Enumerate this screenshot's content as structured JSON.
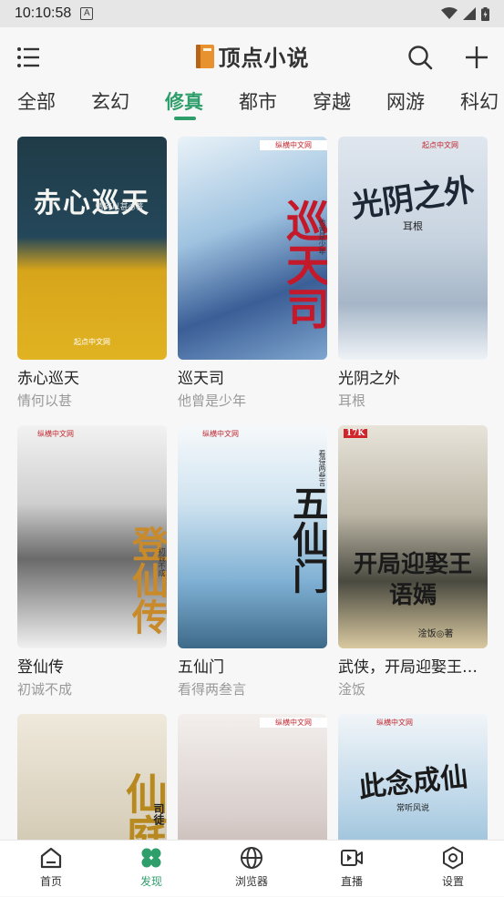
{
  "status_bar": {
    "time": "10:10:58",
    "notification_icon": "A"
  },
  "header": {
    "title": "顶点小说",
    "menu_icon": "menu-icon",
    "book_icon": "book-icon",
    "search_icon": "search-icon",
    "add_icon": "plus-icon"
  },
  "tabs": [
    {
      "label": "全部",
      "active": false
    },
    {
      "label": "玄幻",
      "active": false
    },
    {
      "label": "修真",
      "active": true
    },
    {
      "label": "都市",
      "active": false
    },
    {
      "label": "穿越",
      "active": false
    },
    {
      "label": "网游",
      "active": false
    },
    {
      "label": "科幻",
      "active": false
    }
  ],
  "books": [
    {
      "title": "赤心巡天",
      "author": "情何以甚",
      "cover_text": "赤心巡天",
      "cover_sub": "情何以甚◎著",
      "cover_publisher": "起点中文网"
    },
    {
      "title": "巡天司",
      "author": "他曾是少年",
      "cover_text": "巡天司",
      "cover_sub": "他曾是少年",
      "cover_publisher": "纵横中文网"
    },
    {
      "title": "光阴之外",
      "author": "耳根",
      "cover_text": "光阴之外",
      "cover_sub": "耳根",
      "cover_publisher": "起点中文网"
    },
    {
      "title": "登仙传",
      "author": "初诚不成",
      "cover_text": "登仙传",
      "cover_sub": "初诚不成",
      "cover_publisher": "纵横中文网"
    },
    {
      "title": "五仙门",
      "author": "看得两叁言",
      "cover_text": "五仙门",
      "cover_sub": "看得两叁言",
      "cover_publisher": "纵横中文网"
    },
    {
      "title": "武侠，开局迎娶王语嫣",
      "author": "淦饭",
      "cover_text": "开局迎娶王语嫣",
      "cover_sub": "淦饭◎著",
      "cover_publisher": "17K"
    },
    {
      "title": "",
      "author": "",
      "cover_text": "仙庭",
      "cover_sub": "司徒",
      "cover_publisher": ""
    },
    {
      "title": "",
      "author": "",
      "cover_text": "",
      "cover_sub": "",
      "cover_publisher": "纵横中文网"
    },
    {
      "title": "",
      "author": "",
      "cover_text": "此念成仙",
      "cover_sub": "常听风说",
      "cover_publisher": "纵横中文网"
    }
  ],
  "bottom_nav": [
    {
      "label": "首页",
      "icon": "home-icon",
      "active": false
    },
    {
      "label": "发现",
      "icon": "discover-icon",
      "active": true
    },
    {
      "label": "浏览器",
      "icon": "browser-icon",
      "active": false
    },
    {
      "label": "直播",
      "icon": "live-icon",
      "active": false
    },
    {
      "label": "设置",
      "icon": "settings-icon",
      "active": false
    }
  ],
  "colors": {
    "accent": "#2e9e6a",
    "text": "#222222",
    "muted": "#999999",
    "background": "#f7f7f7"
  }
}
